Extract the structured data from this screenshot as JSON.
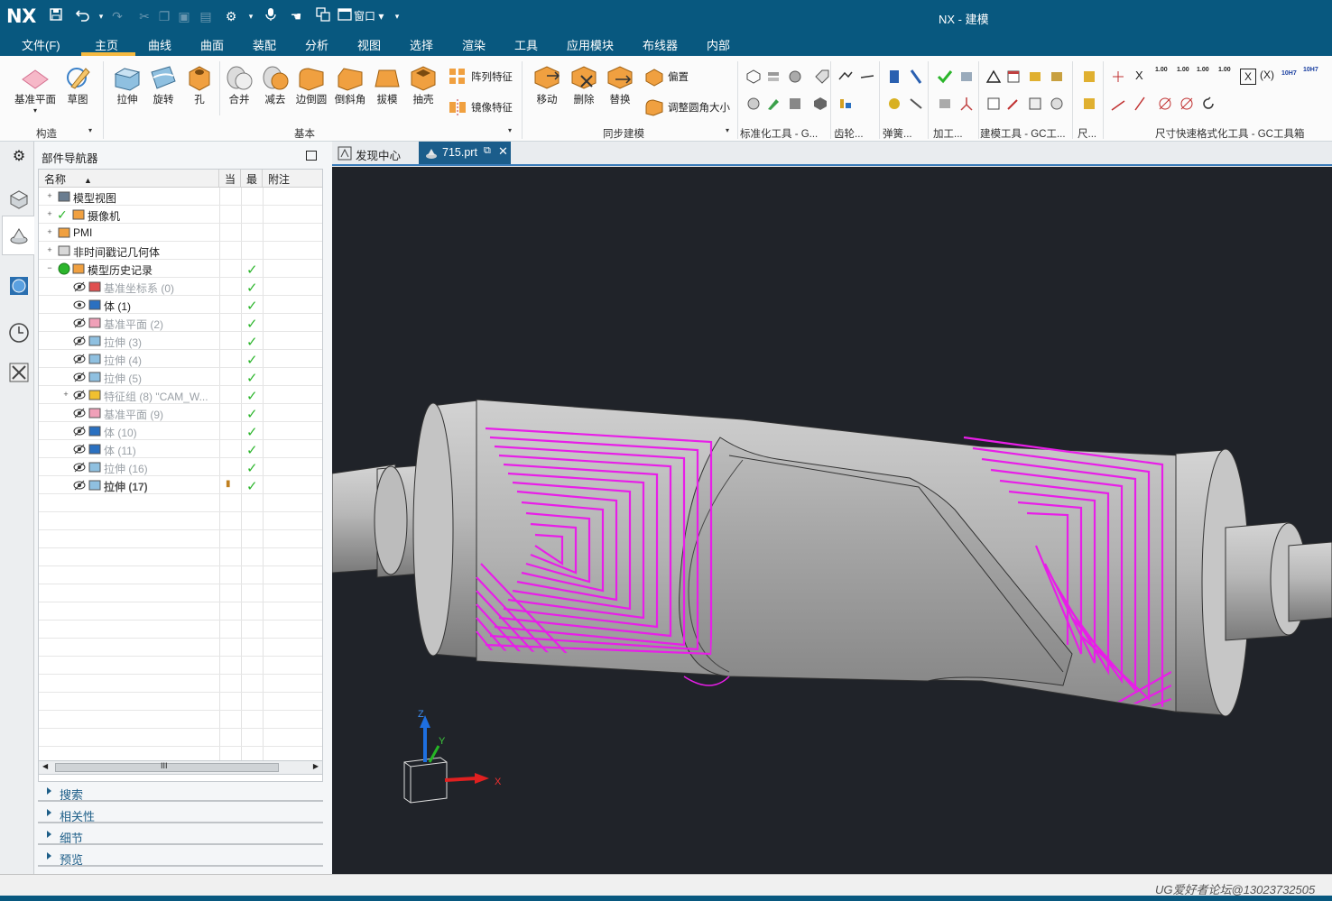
{
  "app": {
    "logo": "NX",
    "title": "NX - 建模",
    "window_menu": "窗口"
  },
  "menu": {
    "items": [
      "文件(F)",
      "主页",
      "曲线",
      "曲面",
      "装配",
      "分析",
      "视图",
      "选择",
      "渲染",
      "工具",
      "应用模块",
      "布线器",
      "内部"
    ],
    "active": "主页"
  },
  "ribbon": {
    "construct": {
      "datum_plane": "基准平面",
      "sketch": "草图",
      "group": "构造"
    },
    "basic": {
      "extrude": "拉伸",
      "revolve": "旋转",
      "hole": "孔",
      "unite": "合并",
      "subtract": "减去",
      "edge_blend": "边倒圆",
      "chamfer": "倒斜角",
      "draft": "拔模",
      "shell": "抽壳",
      "pattern": "阵列特征",
      "mirror": "镜像特征",
      "group": "基本"
    },
    "sync": {
      "move": "移动",
      "delete": "删除",
      "replace": "替换",
      "offset": "偏置",
      "resize_blend": "调整圆角大小",
      "group": "同步建模"
    },
    "groups_right": [
      "标准化工具 - G...",
      "齿轮...",
      "弹簧...",
      "加工...",
      "建模工具 - GC工...",
      "尺...",
      "尺寸快速格式化工具 - GC工具箱"
    ],
    "dim_labels": [
      "1.00",
      "1.00",
      "1.00",
      "1.00"
    ],
    "fit_labels": [
      "10H7",
      "10H7"
    ]
  },
  "navigator": {
    "title": "部件导航器",
    "columns": [
      "名称",
      "当",
      "最",
      "附注"
    ],
    "rows": [
      {
        "label": "模型视图",
        "dim": false,
        "check": false
      },
      {
        "label": "摄像机",
        "dim": false,
        "check": false
      },
      {
        "label": "PMI",
        "dim": false,
        "check": false
      },
      {
        "label": "非时间戳记几何体",
        "dim": false,
        "check": false
      },
      {
        "label": "模型历史记录",
        "dim": false,
        "check": true
      },
      {
        "label": "基准坐标系 (0)",
        "dim": true,
        "check": true
      },
      {
        "label": "体 (1)",
        "dim": false,
        "check": true
      },
      {
        "label": "基准平面 (2)",
        "dim": true,
        "check": true
      },
      {
        "label": "拉伸 (3)",
        "dim": true,
        "check": true
      },
      {
        "label": "拉伸 (4)",
        "dim": true,
        "check": true
      },
      {
        "label": "拉伸 (5)",
        "dim": true,
        "check": true
      },
      {
        "label": "特征组 (8) \"CAM_W...",
        "dim": true,
        "check": true
      },
      {
        "label": "基准平面 (9)",
        "dim": true,
        "check": true
      },
      {
        "label": "体 (10)",
        "dim": true,
        "check": true
      },
      {
        "label": "体 (11)",
        "dim": true,
        "check": true
      },
      {
        "label": "拉伸 (16)",
        "dim": true,
        "check": true
      },
      {
        "label": "拉伸 (17)",
        "dim": false,
        "check": true
      }
    ],
    "scroll_label": "III",
    "sections": [
      "搜索",
      "相关性",
      "细节",
      "预览"
    ]
  },
  "tabs": [
    {
      "label": "发现中心",
      "active": false
    },
    {
      "label": "715.prt",
      "active": true
    }
  ],
  "viewport": {
    "axis_x": "X",
    "axis_y": "Y",
    "axis_z": "Z"
  },
  "watermark": "UG爱好者论坛@13023732505",
  "colors": {
    "titlebar": "#08587f",
    "toolpath": "#e81ee8",
    "viewport_bg": "#202329",
    "part": "#b5b5b5"
  }
}
